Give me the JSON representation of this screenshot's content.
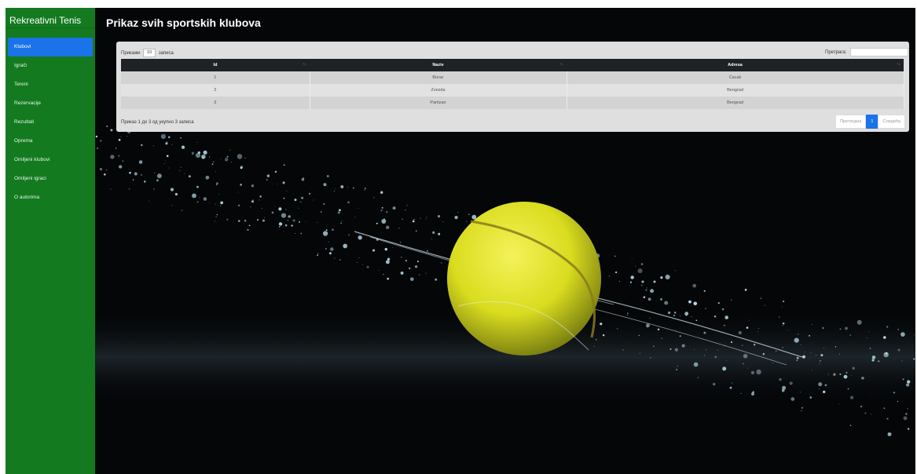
{
  "app": {
    "title": "Rekreativni Tenis"
  },
  "sidebar": {
    "items": [
      {
        "label": "Klubovi",
        "active": true
      },
      {
        "label": "Igrači",
        "active": false
      },
      {
        "label": "Tereni",
        "active": false
      },
      {
        "label": "Rezervacije",
        "active": false
      },
      {
        "label": "Rezultati",
        "active": false
      },
      {
        "label": "Oprema",
        "active": false
      },
      {
        "label": "Omiljeni klubovi",
        "active": false
      },
      {
        "label": "Omiljeni igraci",
        "active": false
      },
      {
        "label": "O autorima",
        "active": false
      }
    ]
  },
  "page": {
    "title": "Prikaz svih sportskih klubova"
  },
  "table_controls": {
    "show_label": "Прикажи",
    "show_value": "10",
    "entries_label": "записа",
    "search_label": "Претрага:",
    "search_value": ""
  },
  "table": {
    "columns": [
      "Id",
      "Naziv",
      "Adresa"
    ],
    "rows": [
      [
        "1",
        "Borac",
        "Cacak"
      ],
      [
        "2",
        "Zvezda",
        "Beograd"
      ],
      [
        "3",
        "Partizan",
        "Beograd"
      ]
    ]
  },
  "footer": {
    "info": "Приказ 1 до 3 од укупно 3 записа",
    "prev": "Претходна",
    "page": "1",
    "next": "Следећа"
  },
  "background": {
    "subject": "tennis-ball-with-water-droplets"
  },
  "colors": {
    "sidebar": "#137a1f",
    "accent": "#1a73e8",
    "table_header": "#1e2125",
    "ball": "#d9dc1e"
  }
}
